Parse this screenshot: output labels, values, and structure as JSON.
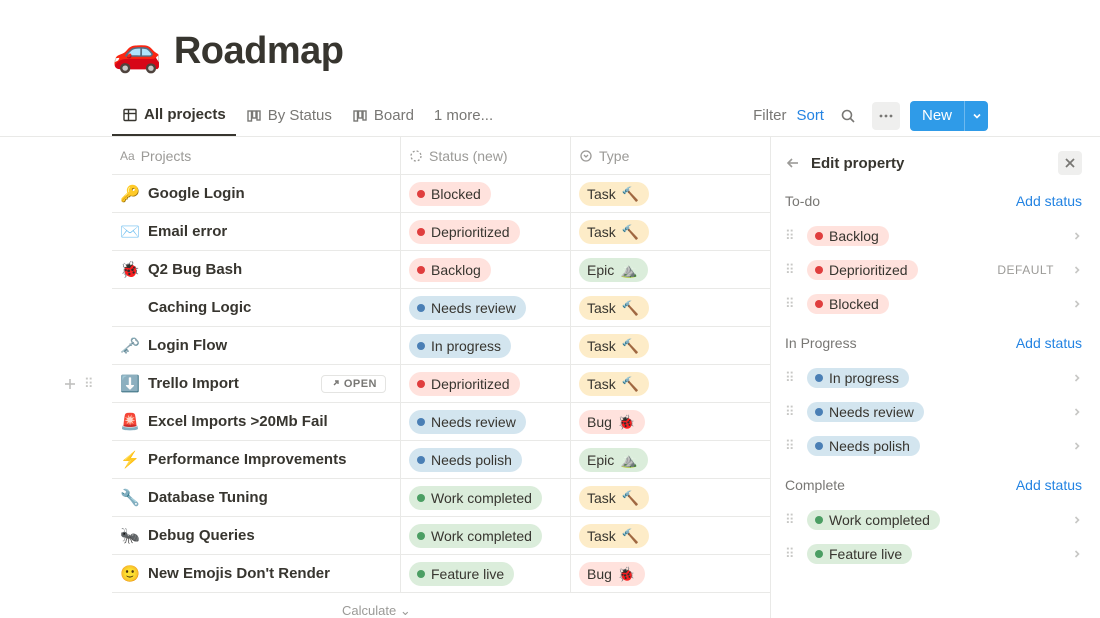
{
  "title_emoji": "🚗",
  "title": "Roadmap",
  "tabs": [
    {
      "label": "All projects"
    },
    {
      "label": "By Status"
    },
    {
      "label": "Board"
    }
  ],
  "tabs_more": "1 more...",
  "toolbar": {
    "filter": "Filter",
    "sort": "Sort",
    "new": "New"
  },
  "columns": {
    "projects": "Projects",
    "status": "Status (new)",
    "type": "Type"
  },
  "colors": {
    "red_bg": "#ffe2dd",
    "red_dot": "#e03e3e",
    "blue_bg": "#d3e5ef",
    "blue_dot": "#4a7fb5",
    "green_bg": "#dbeddb",
    "green_dot": "#4b9e63",
    "yellow_bg": "#fdecc8",
    "greenType_bg": "#dbeddb",
    "redType_bg": "#ffe2dd"
  },
  "rows": [
    {
      "emoji": "🔑",
      "name": "Google Login",
      "status": "Blocked",
      "status_color": "red",
      "type": "Task",
      "type_emoji": "🔨",
      "type_color": "yellow"
    },
    {
      "emoji": "✉️",
      "name": "Email error",
      "status": "Deprioritized",
      "status_color": "red",
      "type": "Task",
      "type_emoji": "🔨",
      "type_color": "yellow"
    },
    {
      "emoji": "🐞",
      "name": "Q2 Bug Bash",
      "status": "Backlog",
      "status_color": "red",
      "type": "Epic",
      "type_emoji": "⛰️",
      "type_color": "green"
    },
    {
      "emoji": "",
      "name": "Caching Logic",
      "status": "Needs review",
      "status_color": "blue",
      "type": "Task",
      "type_emoji": "🔨",
      "type_color": "yellow"
    },
    {
      "emoji": "🗝️",
      "name": "Login Flow",
      "status": "In progress",
      "status_color": "blue",
      "type": "Task",
      "type_emoji": "🔨",
      "type_color": "yellow"
    },
    {
      "emoji": "⬇️",
      "name": "Trello Import",
      "status": "Deprioritized",
      "status_color": "red",
      "type": "Task",
      "type_emoji": "🔨",
      "type_color": "yellow",
      "hover": true
    },
    {
      "emoji": "🚨",
      "name": "Excel Imports >20Mb Fail",
      "status": "Needs review",
      "status_color": "blue",
      "type": "Bug",
      "type_emoji": "🐞",
      "type_color": "red"
    },
    {
      "emoji": "⚡",
      "name": "Performance Improvements",
      "status": "Needs polish",
      "status_color": "blue",
      "type": "Epic",
      "type_emoji": "⛰️",
      "type_color": "green"
    },
    {
      "emoji": "🔧",
      "name": "Database Tuning",
      "status": "Work completed",
      "status_color": "green",
      "type": "Task",
      "type_emoji": "🔨",
      "type_color": "yellow"
    },
    {
      "emoji": "🐜",
      "name": "Debug Queries",
      "status": "Work completed",
      "status_color": "green",
      "type": "Task",
      "type_emoji": "🔨",
      "type_color": "yellow"
    },
    {
      "emoji": "🙂",
      "name": "New Emojis Don't Render",
      "status": "Feature live",
      "status_color": "green",
      "type": "Bug",
      "type_emoji": "🐞",
      "type_color": "red"
    }
  ],
  "calculate": "Calculate",
  "open_label": "OPEN",
  "panel": {
    "title": "Edit property",
    "add_status": "Add status",
    "default_label": "DEFAULT",
    "groups": [
      {
        "label": "To-do",
        "items": [
          {
            "label": "Backlog",
            "color": "red"
          },
          {
            "label": "Deprioritized",
            "color": "red",
            "default": true
          },
          {
            "label": "Blocked",
            "color": "red"
          }
        ]
      },
      {
        "label": "In Progress",
        "items": [
          {
            "label": "In progress",
            "color": "blue"
          },
          {
            "label": "Needs review",
            "color": "blue"
          },
          {
            "label": "Needs polish",
            "color": "blue"
          }
        ]
      },
      {
        "label": "Complete",
        "items": [
          {
            "label": "Work completed",
            "color": "green"
          },
          {
            "label": "Feature live",
            "color": "green"
          }
        ]
      }
    ]
  }
}
